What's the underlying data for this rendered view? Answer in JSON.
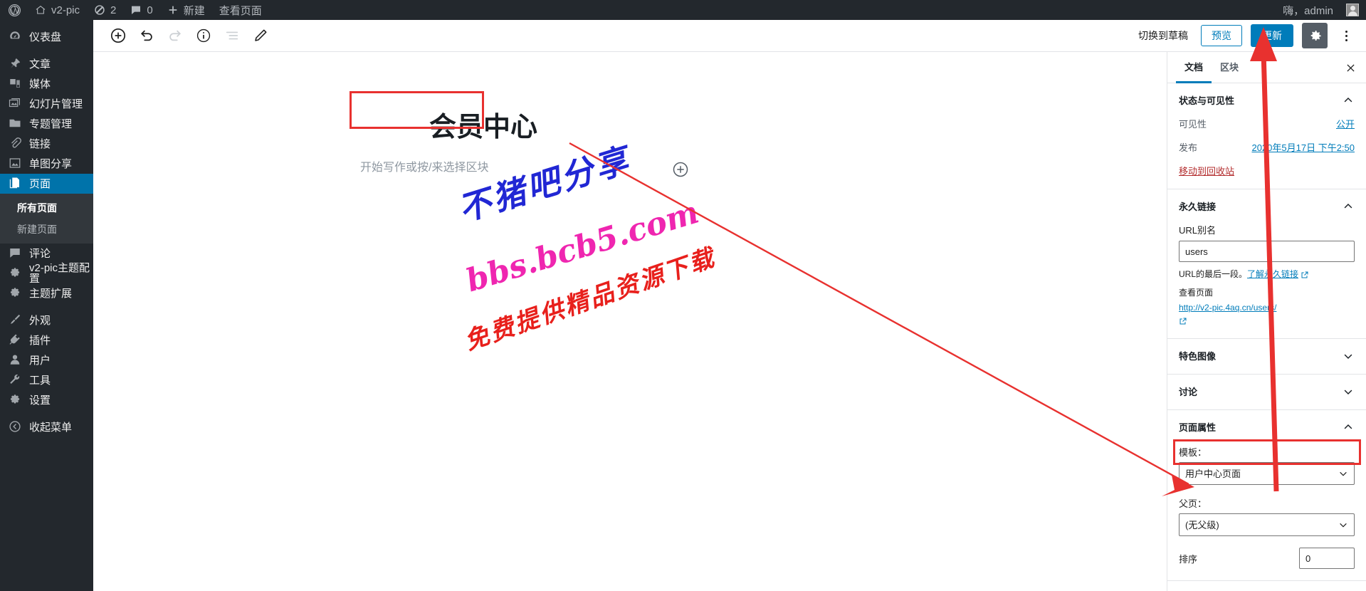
{
  "adminbar": {
    "logo_icon": "wordpress-logo-icon",
    "site_name": "v2-pic",
    "updates_count": "2",
    "comments_count": "0",
    "new_label": "新建",
    "view_page_label": "查看页面",
    "greeting": "嗨，admin"
  },
  "sidebar": {
    "items": [
      {
        "label": "仪表盘",
        "icon": "dashboard-icon",
        "current": false
      },
      {
        "label": "文章",
        "icon": "pin-icon",
        "current": false
      },
      {
        "label": "媒体",
        "icon": "media-icon",
        "current": false
      },
      {
        "label": "幻灯片管理",
        "icon": "slides-icon",
        "current": false
      },
      {
        "label": "专题管理",
        "icon": "folder-icon",
        "current": false
      },
      {
        "label": "链接",
        "icon": "link-icon",
        "current": false
      },
      {
        "label": "单图分享",
        "icon": "image-icon",
        "current": false
      },
      {
        "label": "页面",
        "icon": "pages-icon",
        "current": true
      },
      {
        "label": "评论",
        "icon": "comment-icon",
        "current": false
      },
      {
        "label": "v2-pic主题配置",
        "icon": "gear-icon",
        "current": false
      },
      {
        "label": "主题扩展",
        "icon": "gear-icon",
        "current": false
      },
      {
        "label": "外观",
        "icon": "appearance-icon",
        "current": false
      },
      {
        "label": "插件",
        "icon": "plugin-icon",
        "current": false
      },
      {
        "label": "用户",
        "icon": "users-icon",
        "current": false
      },
      {
        "label": "工具",
        "icon": "tools-icon",
        "current": false
      },
      {
        "label": "设置",
        "icon": "settings-icon",
        "current": false
      },
      {
        "label": "收起菜单",
        "icon": "collapse-icon",
        "current": false
      }
    ],
    "submenu": [
      {
        "label": "所有页面",
        "current": true
      },
      {
        "label": "新建页面",
        "current": false
      }
    ]
  },
  "editor_header": {
    "tools": [
      {
        "name": "add-block-icon",
        "enabled": true
      },
      {
        "name": "undo-icon",
        "enabled": true
      },
      {
        "name": "redo-icon",
        "enabled": false
      },
      {
        "name": "info-icon",
        "enabled": true
      },
      {
        "name": "list-view-icon",
        "enabled": false
      },
      {
        "name": "edit-pencil-icon",
        "enabled": true
      }
    ],
    "switch_to_draft": "切换到草稿",
    "preview": "预览",
    "update": "更新",
    "settings_icon": "gear-icon",
    "more_icon": "more-vertical-icon"
  },
  "editor": {
    "title": "会员中心",
    "paragraph_placeholder": "开始写作或按/来选择区块",
    "inserter_icon": "plus-circle-icon"
  },
  "watermark": {
    "line1": "不猪吧分享",
    "line2": "bbs.bcb5.com",
    "line3": "免费提供精品资源下载"
  },
  "settings_panel": {
    "tabs": [
      {
        "label": "文档",
        "active": true
      },
      {
        "label": "区块",
        "active": false
      }
    ],
    "close_icon": "close-icon",
    "status": {
      "title": "状态与可见性",
      "visibility_label": "可见性",
      "visibility_value": "公开",
      "publish_label": "发布",
      "publish_value": "2020年5月17日 下午2:50",
      "trash_label": "移动到回收站"
    },
    "permalink": {
      "title": "永久链接",
      "slug_label": "URL别名",
      "slug_value": "users",
      "help_text": "URL的最后一段。",
      "help_link": "了解永久链接",
      "view_label": "查看页面",
      "view_url": "http://v2-pic.4aq.cn/users/"
    },
    "featured_image": {
      "title": "特色图像"
    },
    "discussion": {
      "title": "讨论"
    },
    "page_attributes": {
      "title": "页面属性",
      "template_label": "模板：",
      "template_value": "用户中心页面",
      "parent_label": "父页：",
      "parent_value": "(无父级)",
      "order_label": "排序",
      "order_value": "0"
    }
  },
  "colors": {
    "admin_dark": "#23282d",
    "accent_blue": "#007cba",
    "current_menu": "#0073aa",
    "annotation_red": "#e8312f",
    "watermark_blue": "#2127d4",
    "watermark_magenta": "#ef26b0",
    "watermark_red": "#e8201c"
  }
}
